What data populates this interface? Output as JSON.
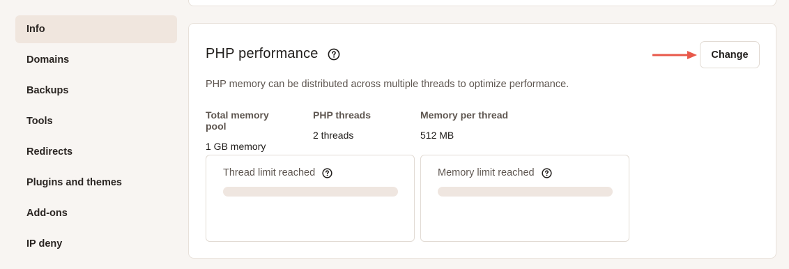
{
  "sidebar": {
    "items": [
      {
        "label": "Info"
      },
      {
        "label": "Domains"
      },
      {
        "label": "Backups"
      },
      {
        "label": "Tools"
      },
      {
        "label": "Redirects"
      },
      {
        "label": "Plugins and themes"
      },
      {
        "label": "Add-ons"
      },
      {
        "label": "IP deny"
      }
    ]
  },
  "php_card": {
    "title": "PHP performance",
    "change_label": "Change",
    "description": "PHP memory can be distributed across multiple threads to optimize performance.",
    "stats": [
      {
        "label": "Total memory pool",
        "value": "1 GB memory"
      },
      {
        "label": "PHP threads",
        "value": "2 threads"
      },
      {
        "label": "Memory per thread",
        "value": "512 MB"
      }
    ],
    "limits": [
      {
        "title": "Thread limit reached"
      },
      {
        "title": "Memory limit reached"
      }
    ]
  }
}
